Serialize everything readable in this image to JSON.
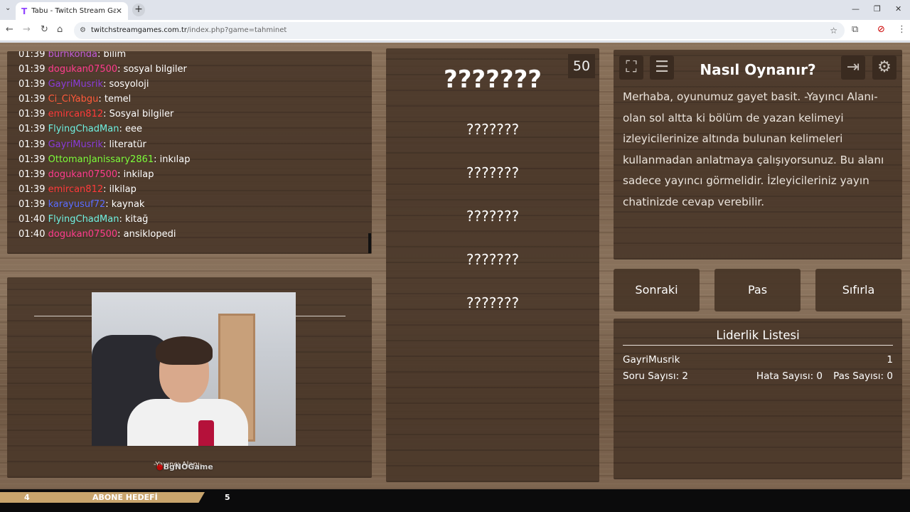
{
  "browser": {
    "tab_title": "Tabu - Twitch Stream Games",
    "url_host": "twitchstreamgames.com.tr",
    "url_path": "/index.php?game=tahminet"
  },
  "chat": [
    {
      "time": "01:39",
      "user": "burhkonda",
      "msg": ": bilim",
      "color": "#c25bd9"
    },
    {
      "time": "01:39",
      "user": "dogukan07500",
      "msg": ": sosyal bilgiler",
      "color": "#ff3b8d"
    },
    {
      "time": "01:39",
      "user": "GayriMusrik",
      "msg": ": sosyoloji",
      "color": "#8a3bd9"
    },
    {
      "time": "01:39",
      "user": "Ci_CiYabgu",
      "msg": ": temel",
      "color": "#ff5a3a"
    },
    {
      "time": "01:39",
      "user": "emircan812",
      "msg": ": Sosyal bilgiler",
      "color": "#ff3a3a"
    },
    {
      "time": "01:39",
      "user": "FlyingChadMan",
      "msg": ": eee",
      "color": "#6ff0e0"
    },
    {
      "time": "01:39",
      "user": "GayriMusrik",
      "msg": ": literatür",
      "color": "#8a3bd9"
    },
    {
      "time": "01:39",
      "user": "OttomanJanissary2861",
      "msg": ": inkılap",
      "color": "#7cfc3a"
    },
    {
      "time": "01:39",
      "user": "dogukan07500",
      "msg": ": inkilap",
      "color": "#ff3b8d"
    },
    {
      "time": "01:39",
      "user": "emircan812",
      "msg": ": ilkilap",
      "color": "#ff3a3a"
    },
    {
      "time": "01:39",
      "user": "karayusuf72",
      "msg": ": kaynak",
      "color": "#5a6cff"
    },
    {
      "time": "01:40",
      "user": "FlyingChadMan",
      "msg": ": kitağ",
      "color": "#6ff0e0"
    },
    {
      "time": "01:40",
      "user": "dogukan07500",
      "msg": ": ansiklopedi",
      "color": "#ff3b8d"
    }
  ],
  "cam": {
    "label": "-Yayıncı Alanı-",
    "logo": "BgNOGame"
  },
  "words": {
    "timer": "50",
    "main": "???????",
    "taboo": [
      "???????",
      "???????",
      "???????",
      "???????",
      "???????"
    ]
  },
  "howto": {
    "title": "Nasıl Oynanır?",
    "text": "Merhaba, oyunumuz gayet basit. -Yayıncı Alanı- olan sol altta ki bölüm de yazan kelimeyi izleyicilerinize altında bulunan kelimeleri kullanmadan anlatmaya çalışıyorsunuz. Bu alanı sadece yayıncı görmelidir. İzleyicileriniz yayın chatinizde cevap verebilir."
  },
  "buttons": {
    "next": "Sonraki",
    "pass": "Pas",
    "reset": "Sıfırla"
  },
  "leaderboard": {
    "title": "Liderlik Listesi",
    "player": "GayriMusrik",
    "score": "1",
    "questions": "Soru Sayısı: 2",
    "errors": "Hata Sayısı: 0",
    "passes": "Pas Sayısı: 0"
  },
  "goal": {
    "current": "4",
    "title": "ABONE HEDEFİ",
    "target": "5",
    "progress": 0.8
  }
}
